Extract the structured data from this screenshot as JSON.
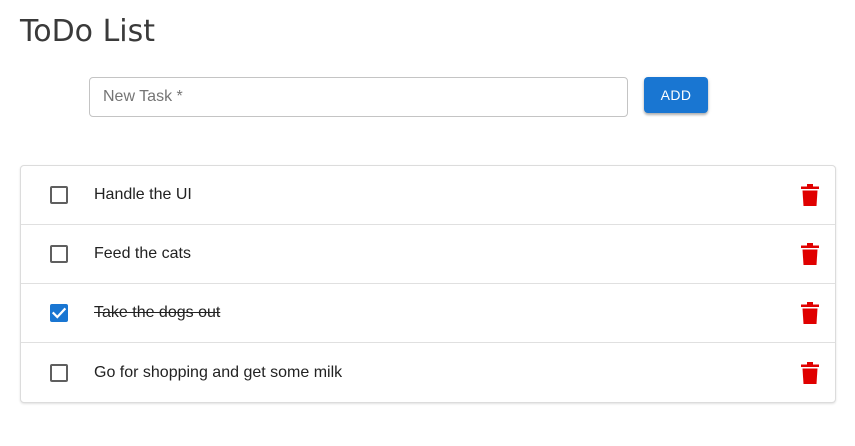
{
  "app": {
    "title": "ToDo List"
  },
  "new_task": {
    "placeholder": "New Task *",
    "value": ""
  },
  "add_button": {
    "label": "ADD"
  },
  "tasks": [
    {
      "label": "Handle the UI",
      "checked": false
    },
    {
      "label": "Feed the cats",
      "checked": false
    },
    {
      "label": "Take the dogs out",
      "checked": true
    },
    {
      "label": "Go for shopping and get some milk",
      "checked": false
    }
  ],
  "colors": {
    "accent": "#1976d2",
    "delete": "#e00000"
  },
  "icons": {
    "delete": "trash-icon",
    "checked": "checkmark-icon"
  }
}
